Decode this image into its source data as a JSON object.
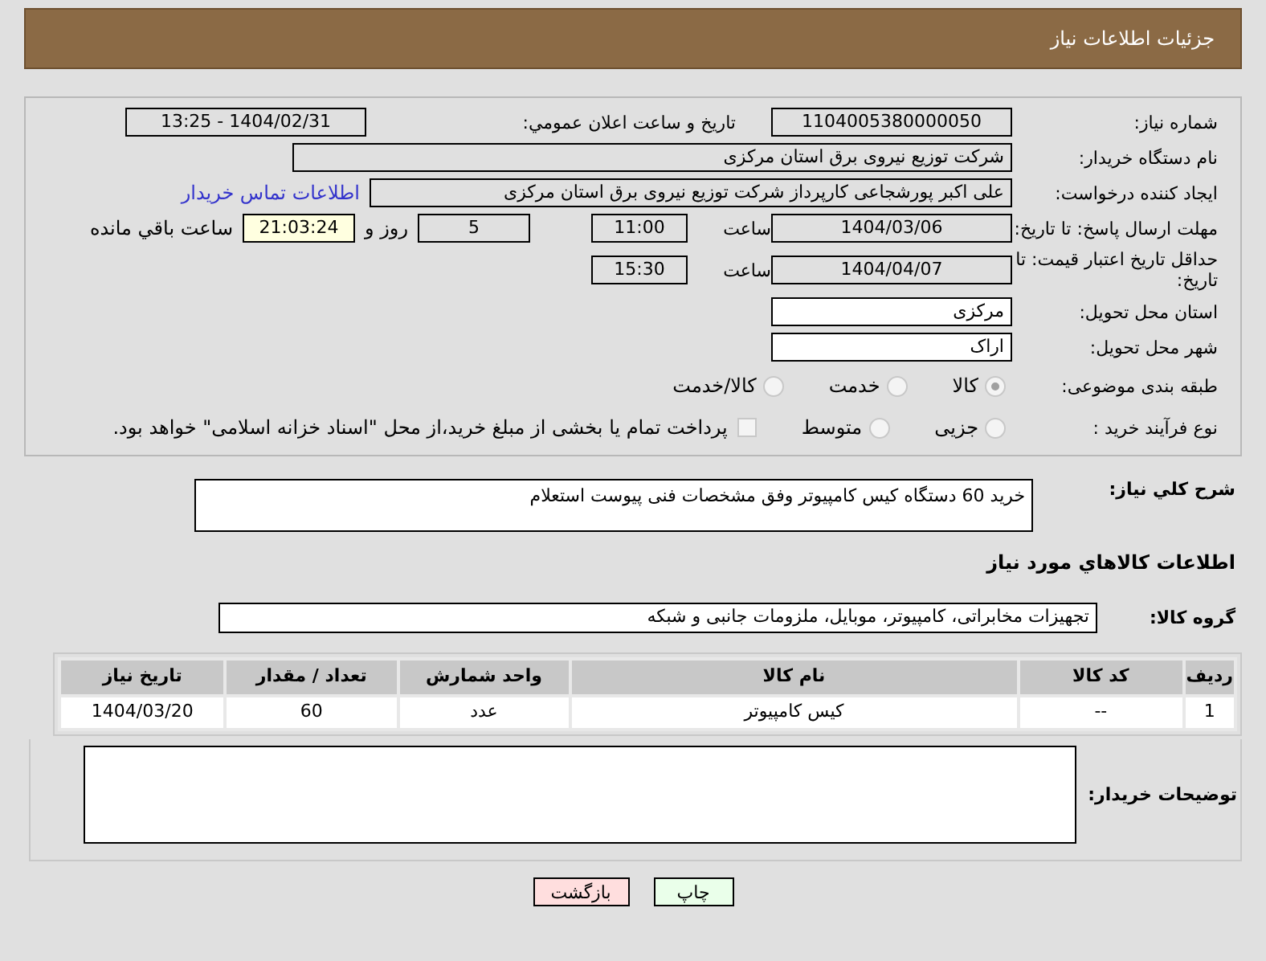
{
  "header": {
    "title": "جزئیات اطلاعات نیاز"
  },
  "need_number": {
    "label": "شماره نیاز:",
    "value": "1104005380000050"
  },
  "announce": {
    "label": "تاریخ و ساعت اعلان عمومي:",
    "value": "1404/02/31 - 13:25"
  },
  "buyer_org": {
    "label": "نام دستگاه خریدار:",
    "value": "شرکت توزیع نیروی برق استان مرکزی"
  },
  "creator": {
    "label": "ایجاد کننده درخواست:",
    "value": "علی اکبر پورشجاعی کارپرداز شرکت توزیع نیروی برق استان مرکزی",
    "link": "اطلاعات تماس خریدار"
  },
  "deadline": {
    "label": "مهلت ارسال پاسخ: تا تاریخ:",
    "date": "1404/03/06",
    "time_label": "ساعت",
    "time": "11:00",
    "days": "5",
    "days_label": "روز و",
    "remaining": "21:03:24",
    "remaining_label": "ساعت باقي مانده"
  },
  "validity": {
    "label": "حداقل تاریخ اعتبار قیمت: تا تاریخ:",
    "date": "1404/04/07",
    "time_label": "ساعت",
    "time": "15:30"
  },
  "province": {
    "label": "استان محل تحویل:",
    "value": "مرکزی"
  },
  "city": {
    "label": "شهر محل تحویل:",
    "value": "اراک"
  },
  "category": {
    "label": "طبقه بندی موضوعی:",
    "options": [
      {
        "label": "کالا",
        "selected": true
      },
      {
        "label": "خدمت",
        "selected": false
      },
      {
        "label": "کالا/خدمت",
        "selected": false
      }
    ]
  },
  "process": {
    "label": "نوع فرآیند خرید :",
    "options": [
      {
        "label": "جزیی",
        "selected": false
      },
      {
        "label": "متوسط",
        "selected": false
      }
    ],
    "payment": {
      "checked": false,
      "text": "پرداخت تمام یا بخشی از مبلغ خرید،از محل \"اسناد خزانه اسلامی\" خواهد بود."
    }
  },
  "description": {
    "label": "شرح کلي نیاز:",
    "value": "خرید 60 دستگاه کیس کامپیوتر وفق مشخصات فنی پیوست استعلام"
  },
  "goods_title": "اطلاعات کالاهاي مورد نیاز",
  "goods_group": {
    "label": "گروه کالا:",
    "value": "تجهیزات مخابراتی، کامپیوتر، موبایل، ملزومات جانبی و شبکه"
  },
  "table": {
    "columns": [
      "ردیف",
      "کد کالا",
      "نام کالا",
      "واحد شمارش",
      "تعداد / مقدار",
      "تاریخ نیاز"
    ],
    "rows": [
      [
        "1",
        "--",
        "کیس کامپیوتر",
        "عدد",
        "60",
        "1404/03/20"
      ]
    ]
  },
  "buyer_notes": {
    "label": "توضیحات خریدار:"
  },
  "buttons": [
    {
      "label": "چاپ",
      "kind": "print"
    },
    {
      "label": "بازگشت",
      "kind": "back"
    }
  ]
}
